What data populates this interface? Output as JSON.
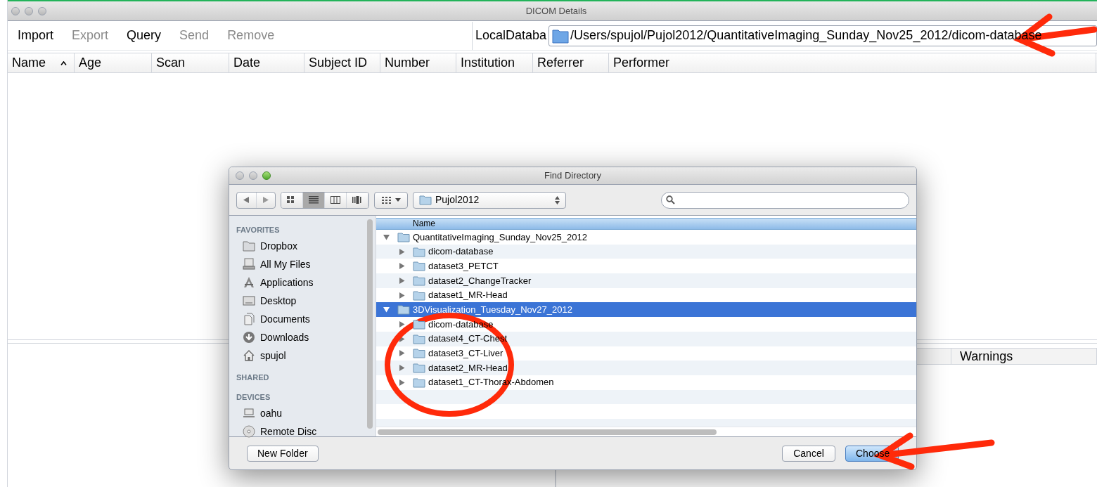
{
  "window": {
    "title": "DICOM Details"
  },
  "toolbar": {
    "actions": [
      {
        "label": "Import",
        "disabled": false
      },
      {
        "label": "Export",
        "disabled": true
      },
      {
        "label": "Query",
        "disabled": false
      },
      {
        "label": "Send",
        "disabled": true
      },
      {
        "label": "Remove",
        "disabled": true
      }
    ],
    "database_label": "LocalDataba",
    "database_path": "/Users/spujol/Pujol2012/QuantitativeImaging_Sunday_Nov25_2012/dicom-database"
  },
  "table": {
    "columns": [
      {
        "label": "Name",
        "sorted": true
      },
      {
        "label": "Age",
        "sorted": false
      },
      {
        "label": "Scan",
        "sorted": false
      },
      {
        "label": "Date",
        "sorted": false
      },
      {
        "label": "Subject ID",
        "sorted": false
      },
      {
        "label": "Number",
        "sorted": false
      },
      {
        "label": "Institution",
        "sorted": false
      },
      {
        "label": "Referrer",
        "sorted": false
      },
      {
        "label": "Performer",
        "sorted": false
      }
    ]
  },
  "lower_panel": {
    "columns": [
      "Warnings"
    ]
  },
  "dialog": {
    "title": "Find Directory",
    "view_modes": [
      {
        "kind": "icons",
        "selected": false
      },
      {
        "kind": "list",
        "selected": true
      },
      {
        "kind": "columns",
        "selected": false
      },
      {
        "kind": "coverflow",
        "selected": false
      }
    ],
    "location": "Pujol2012",
    "sidebar": [
      {
        "heading": "FAVORITES",
        "items": [
          {
            "label": "Dropbox",
            "kind": "folder"
          },
          {
            "label": "All My Files",
            "kind": "files"
          },
          {
            "label": "Applications",
            "kind": "apps"
          },
          {
            "label": "Desktop",
            "kind": "desktop"
          },
          {
            "label": "Documents",
            "kind": "documents"
          },
          {
            "label": "Downloads",
            "kind": "downloads"
          },
          {
            "label": "spujol",
            "kind": "home"
          }
        ]
      },
      {
        "heading": "SHARED"
      },
      {
        "heading": "DEVICES",
        "items": [
          {
            "label": "oahu",
            "kind": "computer"
          },
          {
            "label": "Remote Disc",
            "kind": "disc"
          }
        ]
      }
    ],
    "list_header": "Name",
    "tree": [
      {
        "label": "QuantitativeImaging_Sunday_Nov25_2012",
        "expanded": true,
        "selected": false,
        "children": [
          {
            "label": "dicom-database",
            "expanded": false,
            "selected": false
          },
          {
            "label": "dataset3_PETCT",
            "expanded": false,
            "selected": false
          },
          {
            "label": "dataset2_ChangeTracker",
            "expanded": false,
            "selected": false
          },
          {
            "label": "dataset1_MR-Head",
            "expanded": false,
            "selected": false
          }
        ]
      },
      {
        "label": "3DVisualization_Tuesday_Nov27_2012",
        "expanded": true,
        "selected": true,
        "children": [
          {
            "label": "dicom-database",
            "expanded": false,
            "selected": false
          },
          {
            "label": "dataset4_CT-Chest",
            "expanded": false,
            "selected": false
          },
          {
            "label": "dataset3_CT-Liver",
            "expanded": false,
            "selected": false
          },
          {
            "label": "dataset2_MR-Head",
            "expanded": false,
            "selected": false
          },
          {
            "label": "dataset1_CT-Thorax-Abdomen",
            "expanded": false,
            "selected": false
          }
        ]
      }
    ],
    "buttons": [
      {
        "label": "New Folder",
        "default": false
      },
      {
        "label": "Cancel",
        "default": false
      },
      {
        "label": "Choose",
        "default": true
      }
    ]
  }
}
